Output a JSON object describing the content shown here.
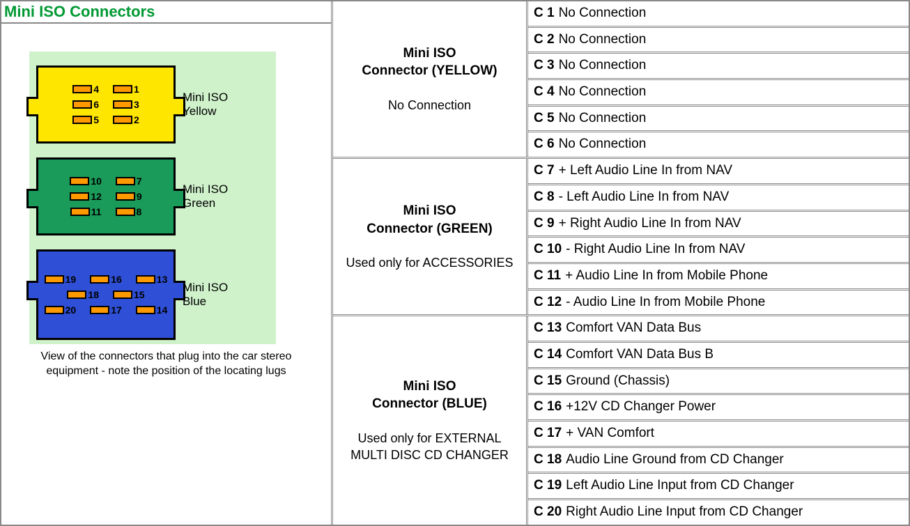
{
  "title": "Mini ISO Connectors",
  "caption": "View of the connectors that plug into the car stereo equipment - note the position of the locating lugs",
  "diagram": {
    "connectors": [
      {
        "color": "yellow",
        "label": "Mini ISO Yellow",
        "layout": "six",
        "rows": [
          [
            4,
            1
          ],
          [
            6,
            3
          ],
          [
            5,
            2
          ]
        ]
      },
      {
        "color": "green",
        "label": "Mini ISO Green",
        "layout": "six",
        "rows": [
          [
            10,
            7
          ],
          [
            12,
            9
          ],
          [
            11,
            8
          ]
        ]
      },
      {
        "color": "blue",
        "label": "Mini ISO Blue",
        "layout": "eight",
        "rows": [
          [
            19,
            16,
            13
          ],
          [
            18,
            15
          ],
          [
            20,
            17,
            14
          ]
        ]
      }
    ]
  },
  "blocks": [
    {
      "name_line1": "Mini ISO",
      "name_line2": "Connector (YELLOW)",
      "note": "No Connection",
      "pins": [
        {
          "id": "C 1",
          "desc": "No Connection"
        },
        {
          "id": "C 2",
          "desc": "No Connection"
        },
        {
          "id": "C 3",
          "desc": "No Connection"
        },
        {
          "id": "C 4",
          "desc": "No Connection"
        },
        {
          "id": "C 5",
          "desc": "No Connection"
        },
        {
          "id": "C 6",
          "desc": "No Connection"
        }
      ]
    },
    {
      "name_line1": "Mini ISO",
      "name_line2": "Connector (GREEN)",
      "note": "Used only for ACCESSORIES",
      "pins": [
        {
          "id": "C 7",
          "desc": "+ Left Audio Line In from NAV"
        },
        {
          "id": "C 8",
          "desc": "- Left Audio Line In from NAV"
        },
        {
          "id": "C 9",
          "desc": "+ Right Audio Line In from NAV"
        },
        {
          "id": "C 10",
          "desc": "- Right Audio Line In from NAV"
        },
        {
          "id": "C 11",
          "desc": "+ Audio Line In from Mobile Phone"
        },
        {
          "id": "C 12",
          "desc": "- Audio Line In from Mobile Phone"
        }
      ]
    },
    {
      "name_line1": "Mini ISO",
      "name_line2": "Connector (BLUE)",
      "note": "Used only for EXTERNAL MULTI DISC CD CHANGER",
      "pins": [
        {
          "id": "C 13",
          "desc": "Comfort VAN Data Bus"
        },
        {
          "id": "C 14",
          "desc": "Comfort VAN Data Bus B"
        },
        {
          "id": "C 15",
          "desc": "Ground (Chassis)"
        },
        {
          "id": "C 16",
          "desc": "+12V CD Changer Power"
        },
        {
          "id": "C 17",
          "desc": "+ VAN Comfort"
        },
        {
          "id": "C 18",
          "desc": "Audio Line Ground from CD Changer"
        },
        {
          "id": "C 19",
          "desc": "Left Audio Line Input from CD Changer"
        },
        {
          "id": "C 20",
          "desc": "Right Audio Line Input from CD Changer"
        }
      ]
    }
  ]
}
